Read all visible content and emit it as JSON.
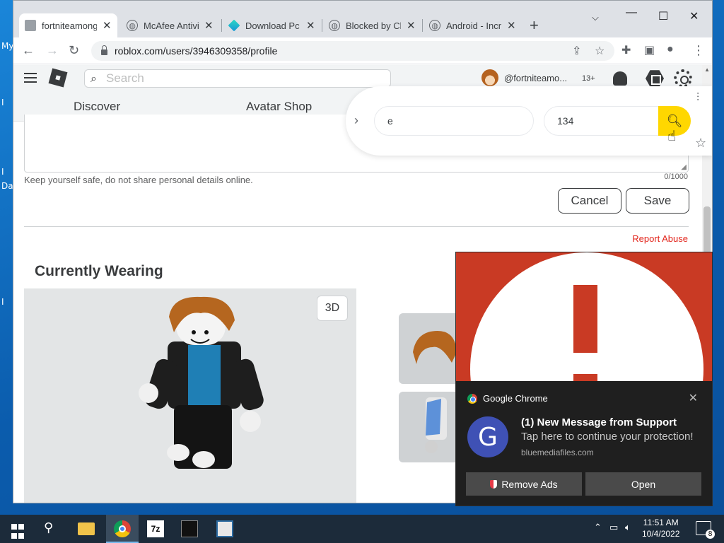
{
  "desktop": {
    "labels": [
      "My",
      "I",
      "I",
      "Da",
      "I"
    ]
  },
  "browser": {
    "tabs": [
      {
        "title": "fortniteamong",
        "active": true
      },
      {
        "title": "McAfee Antivir",
        "active": false
      },
      {
        "title": "Download Pc C",
        "active": false
      },
      {
        "title": "Blocked by Clo",
        "active": false
      },
      {
        "title": "Android - Incr",
        "active": false
      }
    ],
    "url": "roblox.com/users/3946309358/profile"
  },
  "roblox": {
    "search_placeholder": "Search",
    "username": "@fortniteamo...",
    "age_badge": "13+",
    "nav": [
      "Discover",
      "Avatar Shop"
    ],
    "safety_note": "Keep yourself safe, do not share personal details online.",
    "char_counter": "0/1000",
    "cancel_label": "Cancel",
    "save_label": "Save",
    "report_label": "Report Abuse",
    "currently_wearing": "Currently Wearing",
    "btn_3d": "3D"
  },
  "extension_bar": {
    "field1_value": "e",
    "field2_value": "134"
  },
  "notification": {
    "app_name": "Google Chrome",
    "avatar_letter": "G",
    "title": "(1) New Message from Support",
    "body": "Tap here to continue your protection!",
    "source": "bluemediafiles.com",
    "remove_ads_label": "Remove Ads",
    "open_label": "Open",
    "accent": "#3f51b5"
  },
  "taskbar": {
    "time": "11:51 AM",
    "date": "10/4/2022",
    "notification_count": "8",
    "sevenzip_label": "7z"
  }
}
